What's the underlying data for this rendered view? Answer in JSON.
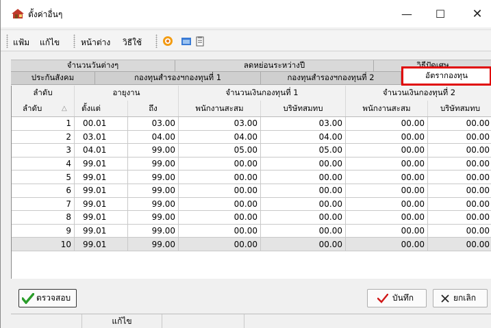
{
  "window": {
    "title": "ตั้งค่าอื่นๆ",
    "controls": {
      "minimize": "—",
      "maximize": "☐",
      "close": "✕"
    }
  },
  "menu": {
    "file": "แฟ้ม",
    "edit": "แก้ไข",
    "window": "หน้าต่าง",
    "help": "วิธีใช้"
  },
  "tabs": {
    "row1": [
      "จำนวนวันต่างๆ",
      "ลดหย่อนระหว่างปี",
      "วิธีปัดเศษ"
    ],
    "row2": [
      "ประกันสังคม",
      "กองทุนสำรองฯกองทุนที่ 1",
      "กองทุนสำรองฯกองทุนที่ 2",
      "อัตรากองทุน"
    ]
  },
  "grid": {
    "group_headers": {
      "seq": "ลำดับ",
      "service": "อายุงาน",
      "fund1": "จำนวนเงินกองทุนที่ 1",
      "fund2": "จำนวนเงินกองทุนที่ 2"
    },
    "columns": {
      "seq": "ลำดับ",
      "sort": "△",
      "from": "ตั้งแต่",
      "to": "ถึง",
      "emp1": "พนักงานสะสม",
      "com1": "บริษัทสมทบ",
      "emp2": "พนักงานสะสม",
      "com2": "บริษัทสมทบ"
    },
    "rows": [
      [
        "1",
        "00.01",
        "03.00",
        "03.00",
        "03.00",
        "00.00",
        "00.00"
      ],
      [
        "2",
        "03.01",
        "04.00",
        "04.00",
        "04.00",
        "00.00",
        "00.00"
      ],
      [
        "3",
        "04.01",
        "99.00",
        "05.00",
        "05.00",
        "00.00",
        "00.00"
      ],
      [
        "4",
        "99.01",
        "99.00",
        "00.00",
        "00.00",
        "00.00",
        "00.00"
      ],
      [
        "5",
        "99.01",
        "99.00",
        "00.00",
        "00.00",
        "00.00",
        "00.00"
      ],
      [
        "6",
        "99.01",
        "99.00",
        "00.00",
        "00.00",
        "00.00",
        "00.00"
      ],
      [
        "7",
        "99.01",
        "99.00",
        "00.00",
        "00.00",
        "00.00",
        "00.00"
      ],
      [
        "8",
        "99.01",
        "99.00",
        "00.00",
        "00.00",
        "00.00",
        "00.00"
      ],
      [
        "9",
        "99.01",
        "99.00",
        "00.00",
        "00.00",
        "00.00",
        "00.00"
      ],
      [
        "10",
        "99.01",
        "99.00",
        "00.00",
        "00.00",
        "00.00",
        "00.00"
      ]
    ]
  },
  "buttons": {
    "check": "ตรวจสอบ",
    "save": "บันทึก",
    "cancel": "ยกเลิก"
  },
  "statusbar": {
    "mode": "แก้ไข"
  },
  "colors": {
    "highlight": "#e00000",
    "check_green": "#2a9d2a",
    "save_red": "#d01818"
  }
}
